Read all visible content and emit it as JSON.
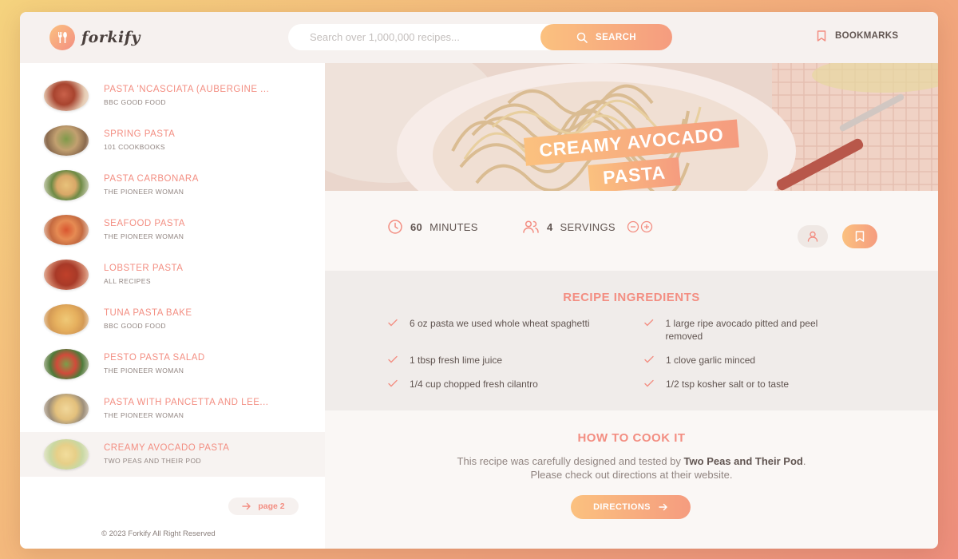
{
  "header": {
    "logo_text": "forkify",
    "search_placeholder": "Search over 1,000,000 recipes...",
    "search_label": "SEARCH",
    "bookmarks_label": "BOOKMARKS"
  },
  "results": [
    {
      "title": "PASTA 'NCASCIATA (AUBERGINE ...",
      "publisher": "BBC GOOD FOOD"
    },
    {
      "title": "SPRING PASTA",
      "publisher": "101 COOKBOOKS"
    },
    {
      "title": "PASTA CARBONARA",
      "publisher": "THE PIONEER WOMAN"
    },
    {
      "title": "SEAFOOD PASTA",
      "publisher": "THE PIONEER WOMAN"
    },
    {
      "title": "LOBSTER PASTA",
      "publisher": "ALL RECIPES"
    },
    {
      "title": "TUNA PASTA BAKE",
      "publisher": "BBC GOOD FOOD"
    },
    {
      "title": "PESTO PASTA SALAD",
      "publisher": "THE PIONEER WOMAN"
    },
    {
      "title": "PASTA WITH PANCETTA AND LEE...",
      "publisher": "THE PIONEER WOMAN"
    },
    {
      "title": "CREAMY AVOCADO PASTA",
      "publisher": "TWO PEAS AND THEIR POD",
      "active": true
    }
  ],
  "pagination": {
    "next_label": "page 2"
  },
  "footer": {
    "copyright": "© 2023 Forkify All Right Reserved"
  },
  "recipe": {
    "title_line1": "CREAMY AVOCADO",
    "title_line2": "PASTA",
    "minutes_value": "60",
    "minutes_label": "MINUTES",
    "servings_value": "4",
    "servings_label": "SERVINGS",
    "ingredients_title": "RECIPE INGREDIENTS",
    "ingredients": [
      "6 oz pasta we used whole wheat spaghetti",
      "1 large ripe avocado pitted and peel removed",
      "1 tbsp fresh lime juice",
      "1 clove garlic minced",
      "1/4 cup chopped fresh cilantro",
      "1/2 tsp kosher salt or to taste"
    ],
    "how_title": "HOW TO COOK IT",
    "how_text_1": "This recipe was carefully designed and tested by",
    "how_publisher": "Two Peas and Their Pod",
    "how_text_2": "Please check out directions at their website.",
    "directions_label": "DIRECTIONS"
  },
  "colors": {
    "accent": "#f38e82",
    "gradient_start": "#fbc17f",
    "gradient_end": "#f59c7f",
    "text": "#615551"
  }
}
